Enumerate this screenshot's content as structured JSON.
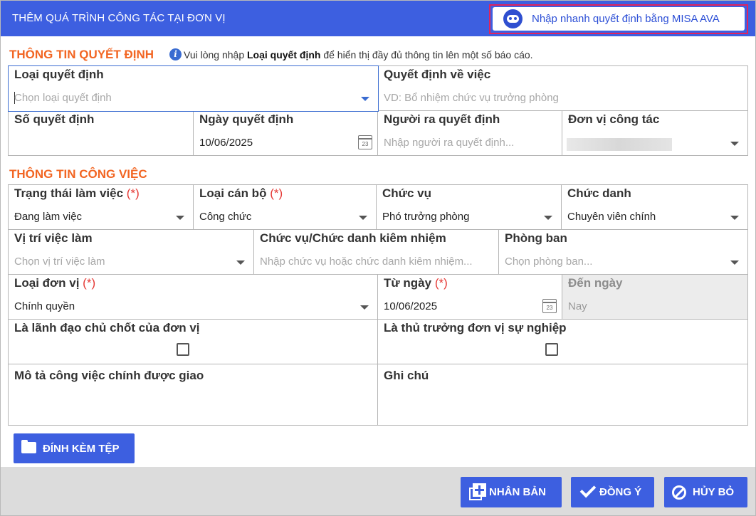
{
  "header": {
    "title": "THÊM QUÁ TRÌNH CÔNG TÁC TẠI ĐƠN VỊ",
    "ava_button": "Nhập nhanh quyết định bằng MISA AVA"
  },
  "decision": {
    "section_title": "THÔNG TIN QUYẾT ĐỊNH",
    "info_prefix": "Vui lòng nhập",
    "info_bold": "Loại quyết định",
    "info_suffix": "để hiển thị đầy đủ thông tin lên một số báo cáo.",
    "type": {
      "label": "Loại quyết định",
      "placeholder": "Chọn loại quyết định"
    },
    "about": {
      "label": "Quyết định về việc",
      "placeholder": "VD: Bổ nhiệm chức vụ trưởng phòng"
    },
    "number": {
      "label": "Số quyết định",
      "value": ""
    },
    "date": {
      "label": "Ngày quyết định",
      "value": "10/06/2025"
    },
    "issuer": {
      "label": "Người ra quyết định",
      "placeholder": "Nhập người ra quyết định..."
    },
    "unit": {
      "label": "Đơn vị công tác"
    }
  },
  "job": {
    "section_title": "THÔNG TIN CÔNG VIỆC",
    "required_mark": "(*)",
    "work_status": {
      "label": "Trạng thái làm việc",
      "value": "Đang làm việc"
    },
    "staff_type": {
      "label": "Loại cán bộ",
      "value": "Công chức"
    },
    "position": {
      "label": "Chức vụ",
      "value": "Phó trưởng phòng"
    },
    "title": {
      "label": "Chức danh",
      "value": "Chuyên viên chính"
    },
    "job_position": {
      "label": "Vị trí việc làm",
      "placeholder": "Chọn vị trí việc làm"
    },
    "concurrent": {
      "label": "Chức vụ/Chức danh kiêm nhiệm",
      "placeholder": "Nhập chức vụ hoặc chức danh kiêm nhiệm..."
    },
    "department": {
      "label": "Phòng ban",
      "placeholder": "Chọn phòng ban..."
    },
    "unit_type": {
      "label": "Loại đơn vị",
      "value": "Chính quyền"
    },
    "from_date": {
      "label": "Từ ngày",
      "value": "10/06/2025"
    },
    "to_date": {
      "label": "Đến ngày",
      "placeholder": "Nay"
    },
    "key_leader": {
      "label": "Là lãnh đạo chủ chốt của đơn vị",
      "checked": false
    },
    "head_of_unit": {
      "label": "Là thủ trưởng đơn vị sự nghiệp",
      "checked": false
    },
    "description": {
      "label": "Mô tả công việc chính được giao",
      "value": ""
    },
    "note": {
      "label": "Ghi chú",
      "value": ""
    }
  },
  "calendar_day": "23",
  "attach_label": "ĐÍNH KÈM TỆP",
  "footer": {
    "duplicate": "NHÂN BẢN",
    "agree": "ĐỒNG Ý",
    "cancel": "HỦY BỎ"
  },
  "colors": {
    "accent": "#3d5fe0",
    "section": "#f26522",
    "required": "#e53935",
    "highlight": "#e0245e"
  }
}
